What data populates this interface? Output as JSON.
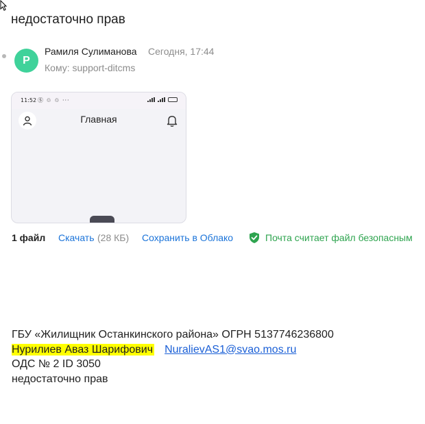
{
  "message": {
    "subject": "недостаточно прав",
    "sender": {
      "avatar_letter": "Р",
      "avatar_color": "#3fd29a",
      "name": "Рамиля Сулиманова",
      "date": "Сегодня, 17:44"
    },
    "recipient": {
      "label": "Кому:",
      "address": "support-ditcms"
    }
  },
  "attachment": {
    "thumbnail": {
      "status_time": "11:52",
      "status_icons": "Ⓢ ♲ ♲ ···",
      "battery": "90",
      "title": "Главная",
      "icons": [
        "profile-icon",
        "bell-icon"
      ]
    },
    "count_label": "1 файл",
    "download_label": "Скачать",
    "size": "(28 КБ)",
    "save_label": "Сохранить в Облако",
    "safe_text": "Почта считает файл безопасным",
    "safe_color": "#2ea44f",
    "link_color": "#1a73d9"
  },
  "body": {
    "line1": "ГБУ «Жилищник Останкинского района» ОГРН 5137746236800",
    "name_highlight": "Нурилиев Аваз Шарифович",
    "email": "NuralievAS1@svao.mos.ru",
    "line3": "ОДС № 2 ID 3050",
    "line4": "недостаточно прав",
    "highlight_color": "#ffff00"
  }
}
